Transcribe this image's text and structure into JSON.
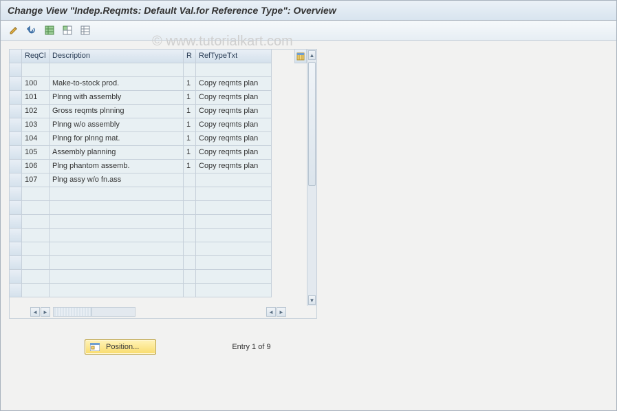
{
  "title": "Change View \"Indep.Reqmts: Default Val.for Reference Type\": Overview",
  "watermark": "© www.tutorialkart.com",
  "toolbar": {
    "change": "Change",
    "undo": "Undo",
    "select_all": "Select All",
    "select_block": "Select Block",
    "deselect_all": "Deselect All"
  },
  "columns": {
    "sel": "",
    "reqcl": "ReqCl",
    "description": "Description",
    "r": "R",
    "reftypetxt": "RefTypeTxt"
  },
  "rows": [
    {
      "reqcl": "",
      "description": "",
      "r": "",
      "reftypetxt": ""
    },
    {
      "reqcl": "100",
      "description": "Make-to-stock prod.",
      "r": "1",
      "reftypetxt": "Copy reqmts plan"
    },
    {
      "reqcl": "101",
      "description": "Plnng with assembly",
      "r": "1",
      "reftypetxt": "Copy reqmts plan"
    },
    {
      "reqcl": "102",
      "description": "Gross reqmts plnning",
      "r": "1",
      "reftypetxt": "Copy reqmts plan"
    },
    {
      "reqcl": "103",
      "description": "Plnng w/o assembly",
      "r": "1",
      "reftypetxt": "Copy reqmts plan"
    },
    {
      "reqcl": "104",
      "description": "Plnng for plnng mat.",
      "r": "1",
      "reftypetxt": "Copy reqmts plan"
    },
    {
      "reqcl": "105",
      "description": "Assembly planning",
      "r": "1",
      "reftypetxt": "Copy reqmts plan"
    },
    {
      "reqcl": "106",
      "description": "Plng phantom assemb.",
      "r": "1",
      "reftypetxt": "Copy reqmts plan"
    },
    {
      "reqcl": "107",
      "description": "Plng assy w/o fn.ass",
      "r": "",
      "reftypetxt": ""
    },
    {
      "reqcl": "",
      "description": "",
      "r": "",
      "reftypetxt": ""
    },
    {
      "reqcl": "",
      "description": "",
      "r": "",
      "reftypetxt": ""
    },
    {
      "reqcl": "",
      "description": "",
      "r": "",
      "reftypetxt": ""
    },
    {
      "reqcl": "",
      "description": "",
      "r": "",
      "reftypetxt": ""
    },
    {
      "reqcl": "",
      "description": "",
      "r": "",
      "reftypetxt": ""
    },
    {
      "reqcl": "",
      "description": "",
      "r": "",
      "reftypetxt": ""
    },
    {
      "reqcl": "",
      "description": "",
      "r": "",
      "reftypetxt": ""
    },
    {
      "reqcl": "",
      "description": "",
      "r": "",
      "reftypetxt": ""
    }
  ],
  "footer": {
    "position_label": "Position...",
    "entry_text": "Entry 1 of 9"
  }
}
